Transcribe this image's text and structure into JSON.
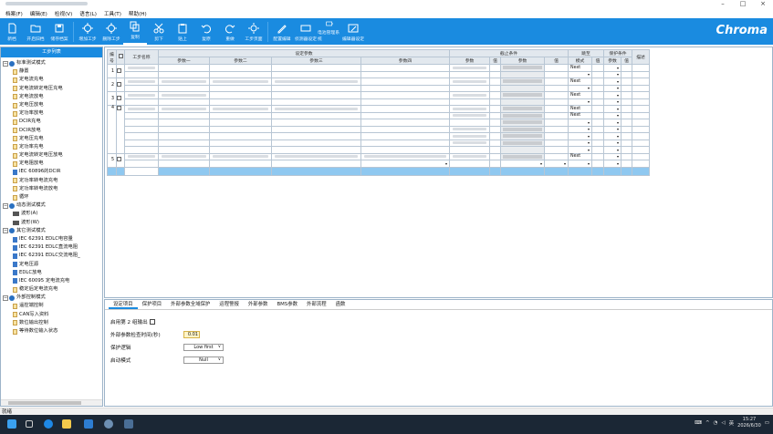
{
  "window": {
    "controls": [
      "–",
      "□",
      "×"
    ]
  },
  "menubar": [
    "档案(F)",
    "编辑(E)",
    "检视(V)",
    "语言(L)",
    "工具(T)",
    "帮助(H)"
  ],
  "toolbar": {
    "buttons": [
      "新档",
      "开启旧档",
      "储存档案",
      "增加工步",
      "删除工步",
      "复制",
      "剪下",
      "贴上",
      "复原",
      "重做",
      "工步页面"
    ],
    "right_buttons": [
      "配置编辑",
      "侦测器设定",
      "电池管理系统",
      "编辑器设定"
    ],
    "active_index": 5,
    "brand": "Chroma",
    "accent": "#1a8be0"
  },
  "left_panel": {
    "title": "工步列表",
    "groups": [
      {
        "label": "标准测试模式",
        "items": [
          "静置",
          "定电流充电",
          "定电流转定电压充电",
          "定电流放电",
          "定电压放电",
          "定功率放电",
          "DCIR充电",
          "DCIR放电",
          "定电压充电",
          "定功率充电",
          "定电流转定电压放电",
          "定电阻放电",
          "IEC 60896的DCIR",
          "定功率转电流充电",
          "定功率转电流放电",
          "循环"
        ]
      },
      {
        "label": "动态测试模式",
        "items": [
          "波形(A)",
          "波形(W)"
        ]
      },
      {
        "label": "其它测试模式",
        "items": [
          "IEC 62391 EDLC电容量",
          "IEC 62391 EDLC直流电阻",
          "IEC 62391 EDLC交流电阻_",
          "定电压源",
          "EDLC放电",
          "IEC 60095 定电流充电",
          "稳定后定电流充电"
        ]
      },
      {
        "label": "外部控制模式",
        "items": [
          "遥控端控制",
          "CAN写入资料",
          "数位输出控制",
          "等待数位输入状态"
        ]
      }
    ]
  },
  "grid": {
    "headers": {
      "no": "编号",
      "step_name": "工步名称",
      "settings": "设定参数",
      "params": [
        "参数一",
        "参数二",
        "参数三",
        "参数四"
      ],
      "cutoff": "截止条件",
      "jump": "跳至",
      "mode": "模式",
      "value": "值",
      "protect": "保护条件",
      "param": "参数",
      "desc": "描述"
    },
    "rows": [
      {
        "no": "1",
        "next": "Next"
      },
      {
        "no": "2",
        "next": "Next"
      },
      {
        "no": "3",
        "next": "Next"
      },
      {
        "no": "4",
        "next": "Next"
      },
      {
        "no": "5",
        "next": "Next"
      }
    ]
  },
  "tabs": [
    "设定项目",
    "保护项目",
    "外部参数全域保护",
    "运程警报",
    "外部参数",
    "BMS参数",
    "外部流程",
    "函数"
  ],
  "form": {
    "enable_output_label": "启用第 2 组输出",
    "ext_check_label": "外部参数检查时间(秒)",
    "ext_check_value": "0.01",
    "protect_logic_label": "保护逻辑",
    "protect_logic_value": "Low first",
    "start_mode_label": "启动模式",
    "start_mode_value": "Null"
  },
  "status": "就绪",
  "taskbar": {
    "ime": "英",
    "time": "15:27",
    "date": "2026/6/30"
  }
}
